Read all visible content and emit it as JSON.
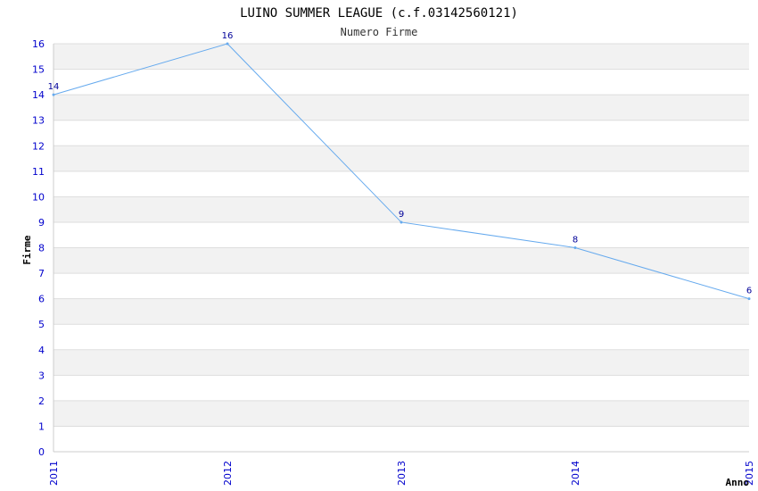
{
  "chart_data": {
    "type": "line",
    "title": "LUINO SUMMER LEAGUE (c.f.03142560121)",
    "subtitle": "Numero Firme",
    "xlabel": "Anno",
    "ylabel": "Firme",
    "x": [
      "2011",
      "2012",
      "2013",
      "2014",
      "2015"
    ],
    "series": [
      {
        "values": [
          14,
          16,
          9,
          8,
          6
        ]
      }
    ],
    "ylim": [
      0,
      16
    ],
    "y_ticks": [
      "0",
      "1",
      "2",
      "3",
      "4",
      "5",
      "6",
      "7",
      "8",
      "9",
      "10",
      "11",
      "12",
      "13",
      "14",
      "15",
      "16"
    ],
    "grid": "horizontal alternating bands",
    "colors": {
      "line": "#66aaee",
      "band": "#f2f2f2",
      "tick": "#0000cc",
      "grid": "#dddddd"
    }
  }
}
